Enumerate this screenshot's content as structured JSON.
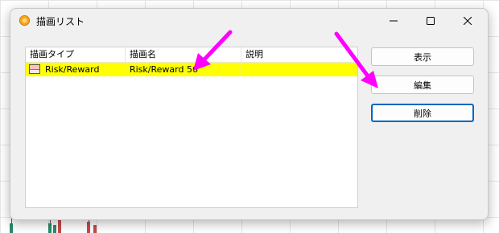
{
  "window": {
    "title": "描画リスト",
    "controls": {
      "minimize": "minimize",
      "maximize": "maximize",
      "close": "close"
    }
  },
  "list": {
    "columns": [
      "描画タイプ",
      "描画名",
      "説明"
    ],
    "rows": [
      {
        "type": "Risk/Reward",
        "name": "Risk/Reward 56",
        "description": "",
        "selected": true,
        "highlight_color": "#ffff00"
      }
    ]
  },
  "buttons": {
    "show": "表示",
    "edit": "編集",
    "delete": "削除"
  },
  "annotations": {
    "arrow_color": "#ff00ff"
  },
  "colors": {
    "accent": "#0067c0",
    "row_highlight": "#ffff00"
  }
}
